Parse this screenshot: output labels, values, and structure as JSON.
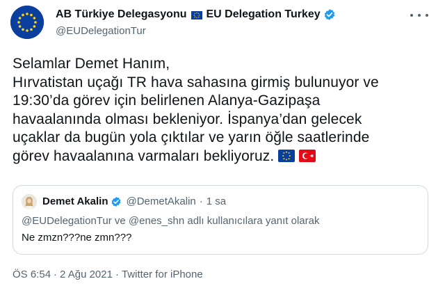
{
  "author": {
    "display_name": "AB Türkiye Delegasyonu",
    "display_name_suffix": "EU Delegation Turkey",
    "handle": "@EUDelegationTur",
    "verified": true,
    "avatar_icon": "eu-flag-avatar"
  },
  "tweet": {
    "lines": [
      "Selamlar Demet Hanım,",
      "Hırvatistan uçağı TR hava sahasına girmiş bulunuyor ve",
      "19:30’da görev için belirlenen Alanya-Gazipaşa",
      "havaalanında olması bekleniyor. İspanya’dan gelecek",
      "uçaklar da bugün yola çıktılar ve yarın öğle saatlerinde",
      "görev havaalanına varmaları bekliyoruz."
    ],
    "emojis": [
      "eu-flag-emoji",
      "turkey-flag-emoji"
    ]
  },
  "quoted": {
    "display_name": "Demet Akalin",
    "handle": "@DemetAkalin",
    "separator": "·",
    "time": "1 sa",
    "reply_context": "@EUDelegationTur ve @enes_shn adlı kullanıcılara yanıt olarak",
    "text": "Ne zmzn???ne zmn???"
  },
  "meta": {
    "time": "ÖS 6:54",
    "date": "2 Ağu 2021",
    "source": "Twitter for iPhone",
    "separator": "·"
  },
  "colors": {
    "text": "#0f1419",
    "secondary": "#536471",
    "border": "#cfd9de",
    "verified": "#1d9bf0",
    "eu_blue": "#0b3f9e",
    "eu_star": "#ffd617",
    "turkey_red": "#e30a17"
  }
}
